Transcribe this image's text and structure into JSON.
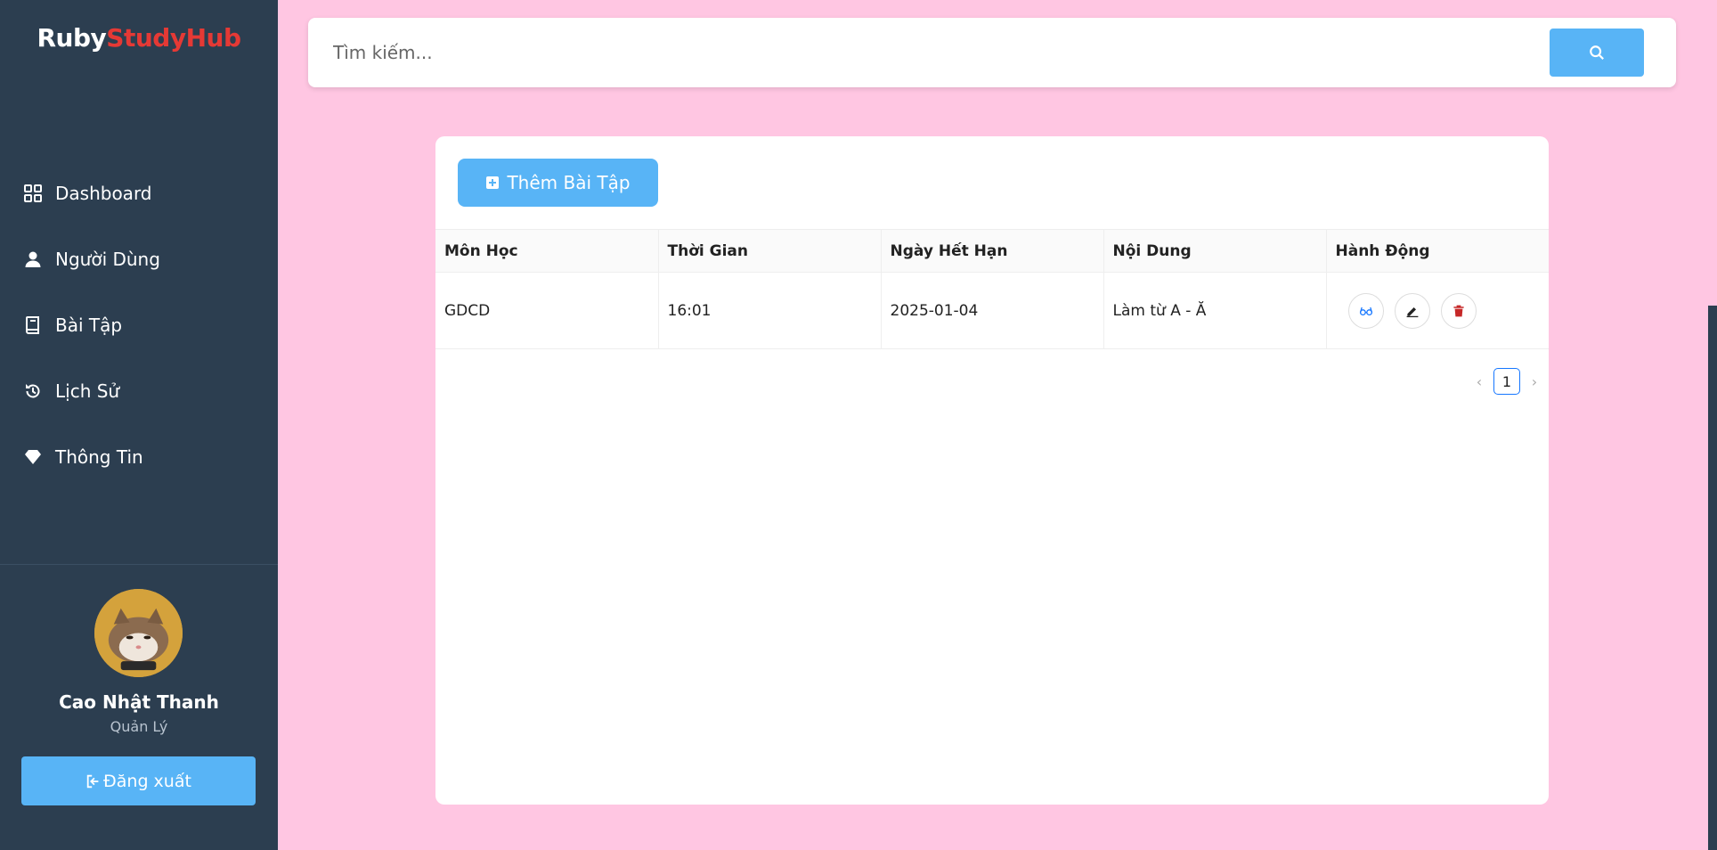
{
  "brand": {
    "part1": "Ruby",
    "part2": "StudyHub"
  },
  "sidebar": {
    "items": [
      {
        "label": "Dashboard",
        "icon": "dashboard-icon"
      },
      {
        "label": "Người Dùng",
        "icon": "user-icon"
      },
      {
        "label": "Bài Tập",
        "icon": "book-icon"
      },
      {
        "label": "Lịch Sử",
        "icon": "history-icon"
      },
      {
        "label": "Thông Tin",
        "icon": "diamond-icon"
      }
    ],
    "user": {
      "name": "Cao Nhật Thanh",
      "role": "Quản Lý"
    },
    "logout_label": "Đăng xuất"
  },
  "search": {
    "placeholder": "Tìm kiếm..."
  },
  "main": {
    "add_button_label": "Thêm Bài Tập",
    "table": {
      "headers": [
        "Môn Học",
        "Thời Gian",
        "Ngày Hết Hạn",
        "Nội Dung",
        "Hành Động"
      ],
      "rows": [
        {
          "subject": "GDCD",
          "time": "16:01",
          "due_date": "2025-01-04",
          "content": "Làm từ A - Ă"
        }
      ]
    },
    "pagination": {
      "current_page": "1"
    }
  },
  "colors": {
    "sidebar": "#2c3e50",
    "accent": "#58b4f6",
    "background": "#ffc6e2",
    "brand_red": "#e53935",
    "delete_red": "#c62828"
  }
}
